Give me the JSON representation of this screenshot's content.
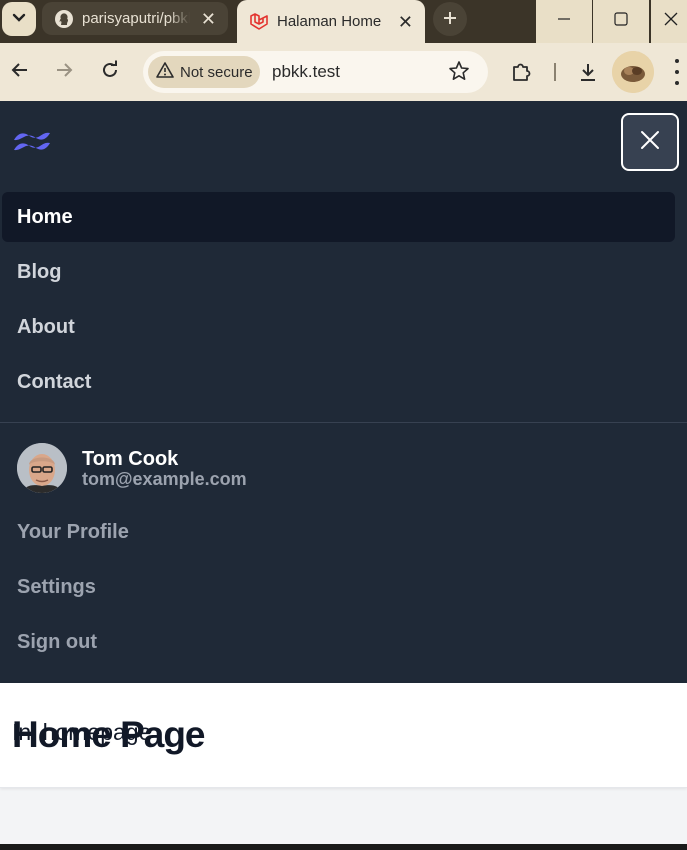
{
  "browser": {
    "tabs": [
      {
        "title": "parisyaputri/pbkk",
        "close": "✕"
      },
      {
        "title": "Halaman Home",
        "close": "✕"
      }
    ],
    "security_label": "Not secure",
    "url": "pbkk.test"
  },
  "nav": {
    "items": [
      {
        "label": "Home",
        "active": true
      },
      {
        "label": "Blog",
        "active": false
      },
      {
        "label": "About",
        "active": false
      },
      {
        "label": "Contact",
        "active": false
      }
    ]
  },
  "user": {
    "name": "Tom Cook",
    "email": "tom@example.com",
    "links": [
      "Your Profile",
      "Settings",
      "Sign out"
    ]
  },
  "header": {
    "title": "Home Page"
  },
  "content": {
    "text": "Ini homepage"
  },
  "colors": {
    "nav_bg": "#1f2937",
    "nav_active_bg": "#111827",
    "brand_accent": "#6366f1",
    "header_bg": "#ffffff",
    "page_bg": "#f3f4f6"
  }
}
